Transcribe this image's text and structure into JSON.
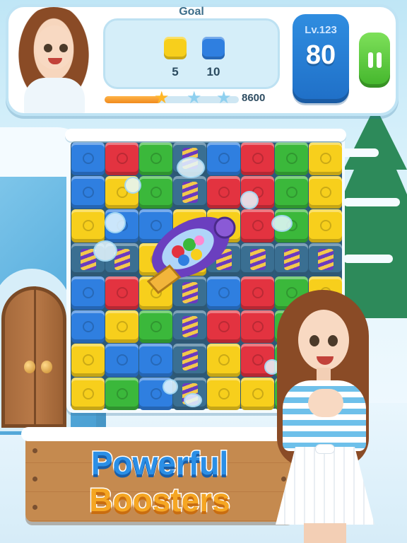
{
  "header": {
    "goal_label": "Goal",
    "goals": [
      {
        "icon": "yellow-cube-icon",
        "color": "#f7cf1c",
        "count": "5"
      },
      {
        "icon": "blue-cube-icon",
        "color": "#2f7fe0",
        "count": "10"
      }
    ],
    "level": "Lv.123",
    "moves": "80",
    "score_target": "8600",
    "progress_fraction": 0.42,
    "stars": [
      "filled-star-icon",
      "empty-star-icon",
      "empty-star-icon"
    ]
  },
  "board": {
    "rows": [
      [
        "blue",
        "red",
        "green",
        "spring",
        "blue",
        "red",
        "green",
        "yellow"
      ],
      [
        "blue",
        "yellow",
        "green",
        "spring",
        "red",
        "red",
        "green",
        "yellow"
      ],
      [
        "yellow",
        "blue",
        "blue",
        "yellow",
        "yellow",
        "red",
        "green",
        "yellow"
      ],
      [
        "spring",
        "spring",
        "yellow",
        "yellow",
        "spring",
        "spring",
        "spring",
        "spring"
      ],
      [
        "blue",
        "red",
        "yellow",
        "spring",
        "blue",
        "red",
        "green",
        "yellow"
      ],
      [
        "blue",
        "yellow",
        "green",
        "spring",
        "red",
        "red",
        "green",
        "yellow"
      ],
      [
        "yellow",
        "blue",
        "blue",
        "spring",
        "yellow",
        "red",
        "green",
        "yellow"
      ],
      [
        "yellow",
        "green",
        "blue",
        "spring",
        "yellow",
        "yellow",
        "green",
        "yellow"
      ]
    ]
  },
  "booster_icon": "bubble-blaster-icon",
  "banner": {
    "line1": "Powerful",
    "line2": "Boosters"
  },
  "colors": {
    "blue": "#2f7fe0",
    "red": "#e33340",
    "green": "#3bb83b",
    "yellow": "#f7cf1c",
    "moves_box": "#1f6fc7",
    "pause_button": "#42b52b"
  }
}
